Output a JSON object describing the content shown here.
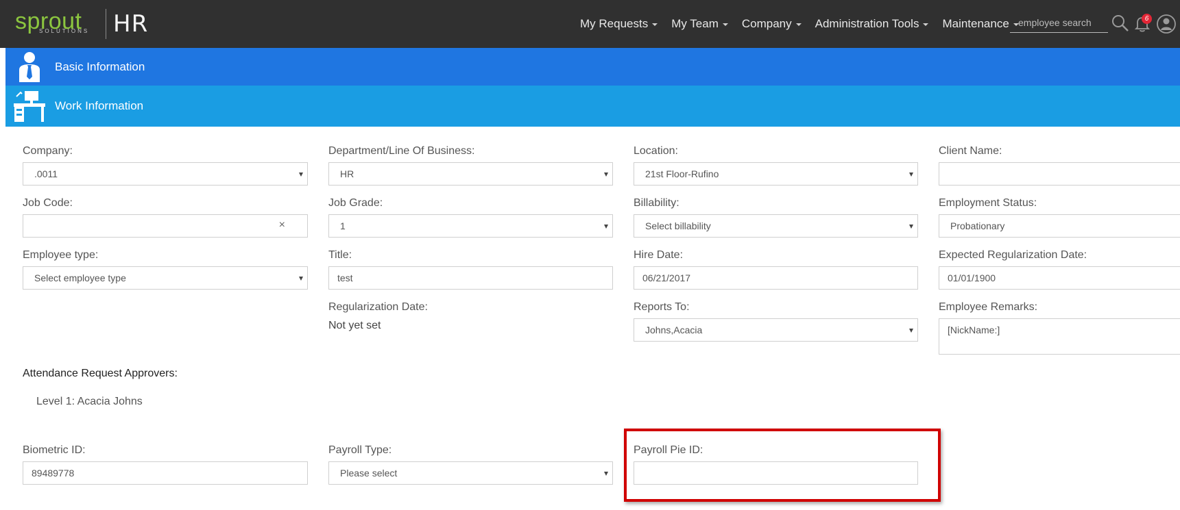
{
  "app": {
    "logo_main": "sprout",
    "logo_sub": "SOLUTIONS",
    "product": "HR"
  },
  "nav": {
    "items": [
      {
        "label": "My Requests"
      },
      {
        "label": "My Team"
      },
      {
        "label": "Company"
      },
      {
        "label": "Administration Tools"
      },
      {
        "label": "Maintenance"
      }
    ],
    "search_placeholder": "employee search",
    "notification_count": "6"
  },
  "sections": {
    "basic": "Basic Information",
    "work": "Work Information"
  },
  "form": {
    "company": {
      "label": "Company:",
      "value": ".0011"
    },
    "department": {
      "label": "Department/Line Of Business:",
      "value": "HR"
    },
    "location": {
      "label": "Location:",
      "value": "21st Floor-Rufino"
    },
    "client_name": {
      "label": "Client Name:",
      "value": ""
    },
    "job_code": {
      "label": "Job Code:",
      "value": "",
      "clear": "×"
    },
    "job_grade": {
      "label": "Job Grade:",
      "value": "1"
    },
    "billability": {
      "label": "Billability:",
      "value": "Select billability"
    },
    "employment_status": {
      "label": "Employment Status:",
      "value": "Probationary"
    },
    "employee_type": {
      "label": "Employee type:",
      "value": "Select employee type"
    },
    "title": {
      "label": "Title:",
      "value": "test"
    },
    "hire_date": {
      "label": "Hire Date:",
      "value": "06/21/2017"
    },
    "expected_regularization": {
      "label": "Expected Regularization Date:",
      "value": "01/01/1900"
    },
    "regularization_date": {
      "label": "Regularization Date:",
      "value": "Not yet set"
    },
    "reports_to": {
      "label": "Reports To:",
      "value": "Johns,Acacia"
    },
    "employee_remarks": {
      "label": "Employee Remarks:",
      "value": "[NickName:]"
    },
    "approvers": {
      "label": "Attendance Request Approvers:",
      "level1": "Level 1: Acacia Johns"
    },
    "biometric_id": {
      "label": "Biometric ID:",
      "value": "89489778"
    },
    "payroll_type": {
      "label": "Payroll Type:",
      "value": "Please select"
    },
    "payroll_pie_id": {
      "label": "Payroll Pie ID:",
      "value": ""
    }
  },
  "colors": {
    "topbar": "#303030",
    "basic_header": "#1f76e1",
    "work_header": "#1a9de3",
    "logo_green": "#8cc63f",
    "highlight": "#d00000"
  }
}
